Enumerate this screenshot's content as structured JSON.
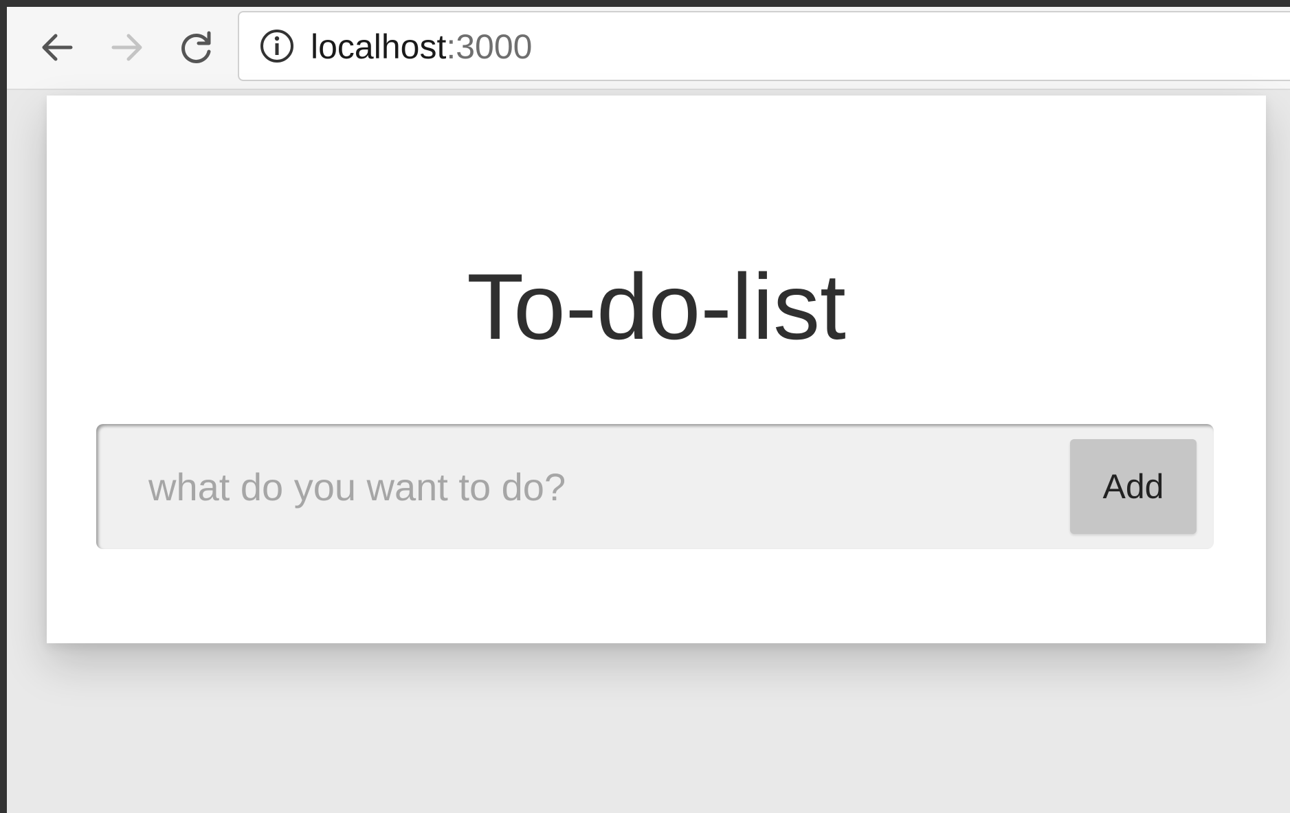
{
  "browser": {
    "url_host": "localhost",
    "url_port": ":3000",
    "icons": {
      "back": "back-arrow-icon",
      "forward": "forward-arrow-icon",
      "reload": "reload-icon",
      "info": "info-icon"
    }
  },
  "page": {
    "title": "To-do-list",
    "input_placeholder": "what do you want to do?",
    "input_value": "",
    "add_button_label": "Add"
  }
}
